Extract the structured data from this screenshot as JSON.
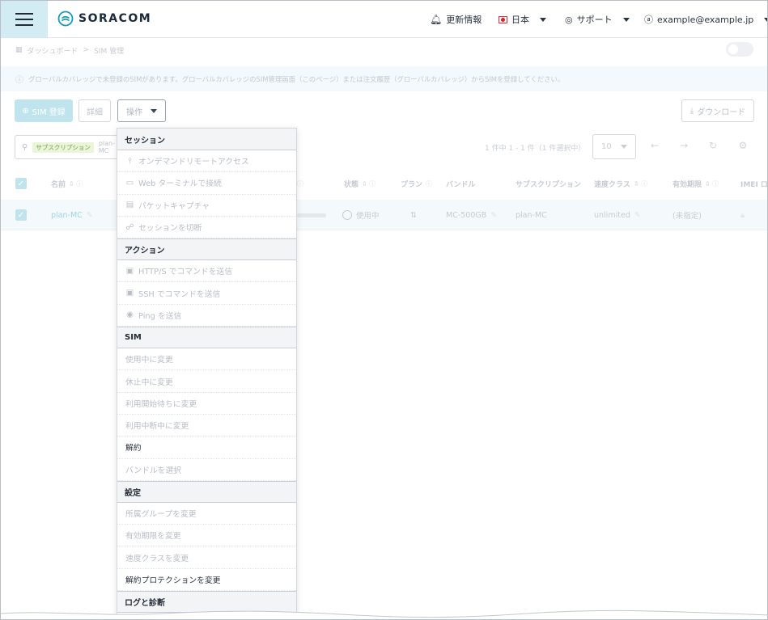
{
  "header": {
    "logo_text": "SORACOM",
    "news_label": "更新情報",
    "language_label": "日本",
    "support_label": "サポート",
    "user_label": "example@example.jp"
  },
  "breadcrumb": {
    "dashboard": "ダッシュボード",
    "separator": ">",
    "current": "SIM 管理"
  },
  "notice": {
    "text": "グローバルカバレッジで未登録のSIMがあります。グローバルカバレッジのSIM管理画面（このページ）または注文履歴（グローバルカバレッジ）からSIMを登録してください。"
  },
  "toolbar": {
    "register_label": "SIM 登録",
    "details_label": "詳細",
    "actions_label": "操作",
    "download_label": "ダウンロード"
  },
  "search": {
    "chip": "サブスクリプション",
    "value": "plan-MC"
  },
  "pager": {
    "summary": "1 件中 1 - 1 件（1 件選択中）",
    "per_page": "10"
  },
  "table": {
    "headers": {
      "name": "名前",
      "status": "状態",
      "plan": "プラン",
      "bundle": "バンドル",
      "subscription": "サブスクリプション",
      "speed_class": "速度クラス",
      "expiry": "有効期限",
      "imei": "IMEI ロ"
    },
    "row": {
      "name": "plan-MC",
      "status": "使用中",
      "bundle": "MC-500GB",
      "subscription": "plan-MC",
      "speed_class": "unlimited",
      "expiry": "(未指定)"
    }
  },
  "menu": {
    "sections": [
      {
        "title": "セッション",
        "items": [
          {
            "icon": "remote-access-icon",
            "glyph": "⫯",
            "label": "オンデマンドリモートアクセス",
            "enabled": false
          },
          {
            "icon": "terminal-icon",
            "glyph": "▭",
            "label": "Web ターミナルで接続",
            "enabled": false
          },
          {
            "icon": "packet-capture-icon",
            "glyph": "▤",
            "label": "パケットキャプチャ",
            "enabled": false
          },
          {
            "icon": "disconnect-icon",
            "glyph": "☍",
            "label": "セッションを切断",
            "enabled": false
          }
        ]
      },
      {
        "title": "アクション",
        "items": [
          {
            "icon": "http-command-icon",
            "glyph": "▣",
            "label": "HTTP/S でコマンドを送信",
            "enabled": false
          },
          {
            "icon": "ssh-command-icon",
            "glyph": "▣",
            "label": "SSH でコマンドを送信",
            "enabled": false
          },
          {
            "icon": "ping-icon",
            "glyph": "◉",
            "label": "Ping を送信",
            "enabled": false
          }
        ]
      },
      {
        "title": "SIM",
        "items": [
          {
            "label": "使用中に変更",
            "enabled": false
          },
          {
            "label": "休止中に変更",
            "enabled": false
          },
          {
            "label": "利用開始待ちに変更",
            "enabled": false
          },
          {
            "label": "利用中断中に変更",
            "enabled": false
          },
          {
            "label": "解約",
            "enabled": true
          },
          {
            "label": "バンドルを選択",
            "enabled": false
          }
        ]
      },
      {
        "title": "設定",
        "items": [
          {
            "label": "所属グループを変更",
            "enabled": false
          },
          {
            "label": "有効期限を変更",
            "enabled": false
          },
          {
            "label": "速度クラスを変更",
            "enabled": false
          },
          {
            "label": "解約プロテクションを変更",
            "enabled": true
          }
        ]
      },
      {
        "title": "ログと診断",
        "items": []
      }
    ]
  },
  "colors": {
    "accent": "#1b9ab8",
    "menu_button_bg": "#d3ecf4",
    "primary_button_bg": "#bfe4ee",
    "notice_bg": "#f3f9fc"
  }
}
